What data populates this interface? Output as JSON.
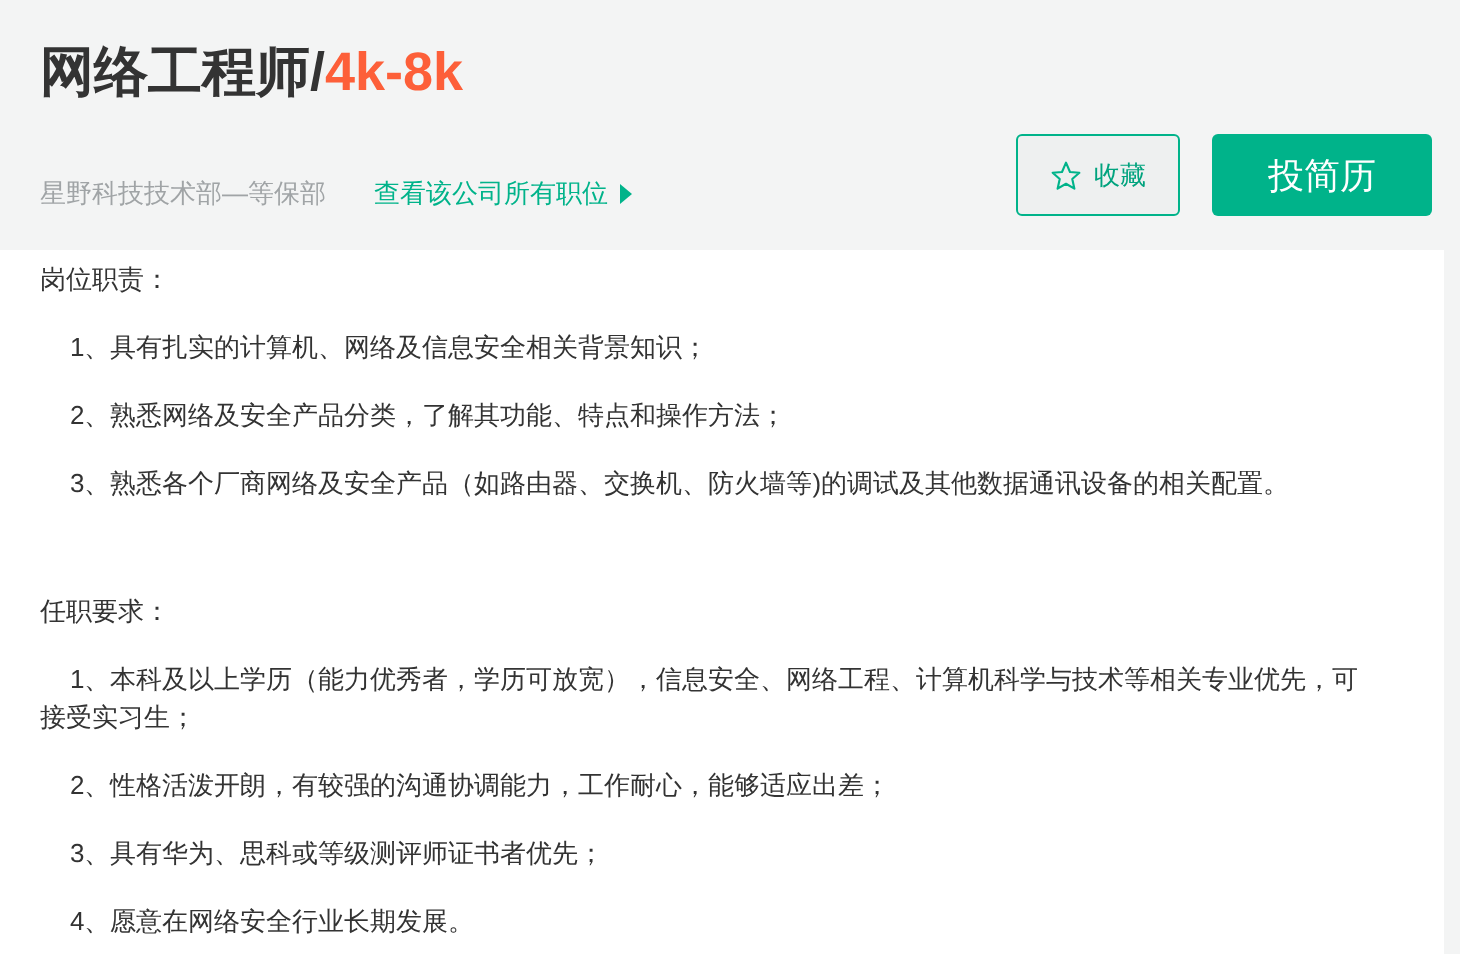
{
  "job": {
    "title": "网络工程师/",
    "salary": "4k-8k",
    "company": "星野科技技术部—等保部",
    "company_link": "查看该公司所有职位"
  },
  "buttons": {
    "favorite": "收藏",
    "apply": "投简历"
  },
  "sections": [
    {
      "heading": "岗位职责：",
      "items": [
        "1、具有扎实的计算机、网络及信息安全相关背景知识；",
        "2、熟悉网络及安全产品分类，了解其功能、特点和操作方法；",
        "3、熟悉各个厂商网络及安全产品（如路由器、交换机、防火墙等)的调试及其他数据通讯设备的相关配置。"
      ]
    },
    {
      "heading": "任职要求：",
      "items": [
        "1、本科及以上学历（能力优秀者，学历可放宽），信息安全、网络工程、计算机科学与技术等相关专业优先，可接受实习生；",
        "2、性格活泼开朗，有较强的沟通协调能力，工作耐心，能够适应出差；",
        "3、具有华为、思科或等级测评师证书者优先；",
        "4、愿意在网络安全行业长期发展。"
      ]
    }
  ]
}
